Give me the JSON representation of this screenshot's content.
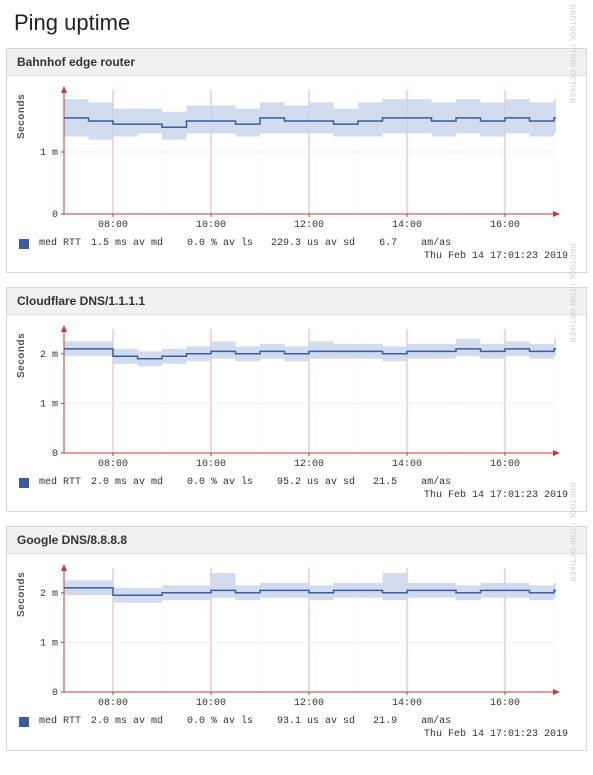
{
  "page": {
    "title": "Ping uptime",
    "ylabel": "Seconds",
    "side_caption": "RRDTOOL / TOBI OETIKER"
  },
  "charts": [
    {
      "title": "Bahnhof edge router",
      "legend_name": "med RTT",
      "stats_text": "1.5 ms av md    0.0 % av ls   229.3 us av sd    6.7    am/as",
      "timestamp": "Thu Feb 14 17:01:23 2019"
    },
    {
      "title": "Cloudflare DNS/1.1.1.1",
      "legend_name": "med RTT",
      "stats_text": "2.0 ms av md    0.0 % av ls    95.2 us av sd   21.5    am/as",
      "timestamp": "Thu Feb 14 17:01:23 2019"
    },
    {
      "title": "Google DNS/8.8.8.8",
      "legend_name": "med RTT",
      "stats_text": "2.0 ms av md    0.0 % av ls    93.1 us av sd   21.9    am/as",
      "timestamp": "Thu Feb 14 17:01:23 2019"
    }
  ],
  "chart_data": [
    {
      "type": "line",
      "title": "Bahnhof edge router",
      "xlabel": "",
      "ylabel": "Seconds",
      "ylim": [
        0,
        2.0
      ],
      "x_ticks": [
        "08:00",
        "10:00",
        "12:00",
        "14:00",
        "16:00"
      ],
      "y_ticks": [
        {
          "v": 0,
          "l": "0"
        },
        {
          "v": 1,
          "l": "1 m"
        }
      ],
      "series": [
        {
          "name": "med RTT",
          "color": "#3b5ca0",
          "x": [
            7.0,
            7.5,
            8.0,
            8.5,
            9.0,
            9.5,
            10.0,
            10.5,
            11.0,
            11.5,
            12.0,
            12.5,
            13.0,
            13.5,
            14.0,
            14.5,
            15.0,
            15.5,
            16.0,
            16.5,
            17.0
          ],
          "values": [
            1.55,
            1.5,
            1.45,
            1.45,
            1.4,
            1.5,
            1.5,
            1.45,
            1.55,
            1.5,
            1.5,
            1.45,
            1.5,
            1.55,
            1.55,
            1.5,
            1.55,
            1.5,
            1.55,
            1.5,
            1.55
          ],
          "band_low": [
            1.25,
            1.2,
            1.25,
            1.3,
            1.2,
            1.3,
            1.3,
            1.25,
            1.3,
            1.3,
            1.3,
            1.25,
            1.25,
            1.3,
            1.3,
            1.25,
            1.3,
            1.25,
            1.3,
            1.25,
            1.3
          ],
          "band_high": [
            1.85,
            1.8,
            1.7,
            1.7,
            1.65,
            1.75,
            1.75,
            1.7,
            1.8,
            1.75,
            1.8,
            1.7,
            1.8,
            1.85,
            1.85,
            1.8,
            1.85,
            1.8,
            1.85,
            1.8,
            1.85
          ]
        }
      ]
    },
    {
      "type": "line",
      "title": "Cloudflare DNS/1.1.1.1",
      "xlabel": "",
      "ylabel": "Seconds",
      "ylim": [
        0,
        2.5
      ],
      "x_ticks": [
        "08:00",
        "10:00",
        "12:00",
        "14:00",
        "16:00"
      ],
      "y_ticks": [
        {
          "v": 0,
          "l": "0"
        },
        {
          "v": 1,
          "l": "1 m"
        },
        {
          "v": 2,
          "l": "2 m"
        }
      ],
      "series": [
        {
          "name": "med RTT",
          "color": "#3b5ca0",
          "x": [
            7.0,
            7.5,
            8.0,
            8.5,
            9.0,
            9.5,
            10.0,
            10.5,
            11.0,
            11.5,
            12.0,
            12.5,
            13.0,
            13.5,
            14.0,
            14.5,
            15.0,
            15.5,
            16.0,
            16.5,
            17.0
          ],
          "values": [
            2.1,
            2.1,
            1.95,
            1.9,
            1.95,
            2.0,
            2.05,
            2.0,
            2.05,
            2.0,
            2.05,
            2.05,
            2.05,
            2.0,
            2.05,
            2.05,
            2.1,
            2.05,
            2.1,
            2.05,
            2.1
          ],
          "band_low": [
            1.95,
            1.95,
            1.8,
            1.75,
            1.8,
            1.85,
            1.9,
            1.85,
            1.9,
            1.85,
            1.9,
            1.9,
            1.9,
            1.85,
            1.9,
            1.9,
            1.95,
            1.9,
            1.95,
            1.9,
            1.95
          ],
          "band_high": [
            2.25,
            2.25,
            2.1,
            2.05,
            2.1,
            2.15,
            2.25,
            2.15,
            2.2,
            2.15,
            2.25,
            2.2,
            2.2,
            2.15,
            2.2,
            2.2,
            2.3,
            2.2,
            2.25,
            2.2,
            2.3
          ]
        }
      ]
    },
    {
      "type": "line",
      "title": "Google DNS/8.8.8.8",
      "xlabel": "",
      "ylabel": "Seconds",
      "ylim": [
        0,
        2.5
      ],
      "x_ticks": [
        "08:00",
        "10:00",
        "12:00",
        "14:00",
        "16:00"
      ],
      "y_ticks": [
        {
          "v": 0,
          "l": "0"
        },
        {
          "v": 1,
          "l": "1 m"
        },
        {
          "v": 2,
          "l": "2 m"
        }
      ],
      "series": [
        {
          "name": "med RTT",
          "color": "#3b5ca0",
          "x": [
            7.0,
            7.5,
            8.0,
            8.5,
            9.0,
            9.5,
            10.0,
            10.5,
            11.0,
            11.5,
            12.0,
            12.5,
            13.0,
            13.5,
            14.0,
            14.5,
            15.0,
            15.5,
            16.0,
            16.5,
            17.0
          ],
          "values": [
            2.1,
            2.1,
            1.95,
            1.95,
            2.0,
            2.0,
            2.05,
            2.0,
            2.05,
            2.05,
            2.0,
            2.05,
            2.05,
            2.0,
            2.05,
            2.05,
            2.0,
            2.05,
            2.05,
            2.0,
            2.05
          ],
          "band_low": [
            1.95,
            1.95,
            1.8,
            1.8,
            1.85,
            1.85,
            1.9,
            1.85,
            1.9,
            1.9,
            1.85,
            1.9,
            1.9,
            1.85,
            1.9,
            1.9,
            1.85,
            1.9,
            1.9,
            1.85,
            1.9
          ],
          "band_high": [
            2.25,
            2.25,
            2.1,
            2.1,
            2.15,
            2.15,
            2.4,
            2.15,
            2.2,
            2.2,
            2.15,
            2.2,
            2.2,
            2.4,
            2.2,
            2.2,
            2.15,
            2.2,
            2.2,
            2.15,
            2.2
          ]
        }
      ]
    }
  ]
}
